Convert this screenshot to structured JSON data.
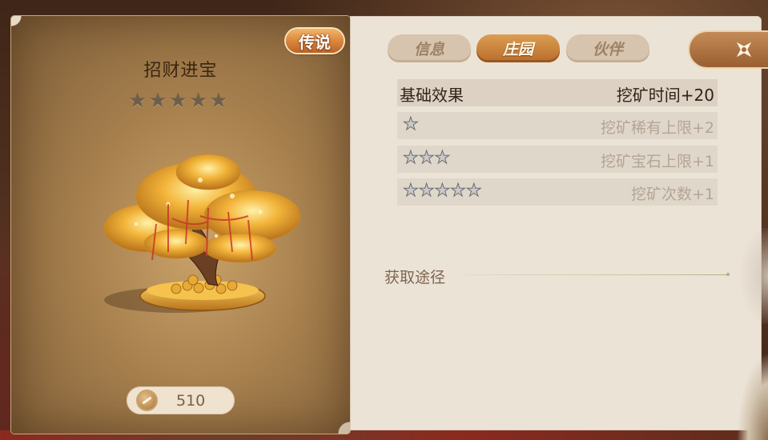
{
  "item": {
    "name": "招财进宝",
    "rarity_label": "传说",
    "star_icons": [
      "★",
      "★",
      "★",
      "★",
      "★"
    ],
    "currency_icon": "coin-icon",
    "currency_value": "510"
  },
  "tabs": [
    {
      "label": "信息",
      "active": false
    },
    {
      "label": "庄园",
      "active": true
    },
    {
      "label": "伙伴",
      "active": false
    }
  ],
  "close_icon": "close-icon",
  "effects": {
    "base_label": "基础效果",
    "base_value": "挖矿时间+20",
    "rows": [
      {
        "stars": "★",
        "value": "挖矿稀有上限+2"
      },
      {
        "stars": "★★★",
        "value": "挖矿宝石上限+1"
      },
      {
        "stars": "★★★★★",
        "value": "挖矿次数+1"
      }
    ]
  },
  "acquire": {
    "label": "获取途径"
  },
  "colors": {
    "active_tab": "#c97f3a",
    "inactive_tab": "#d7c4ae",
    "panel_bg": "#ece3d7",
    "badge": "#d8823a"
  }
}
